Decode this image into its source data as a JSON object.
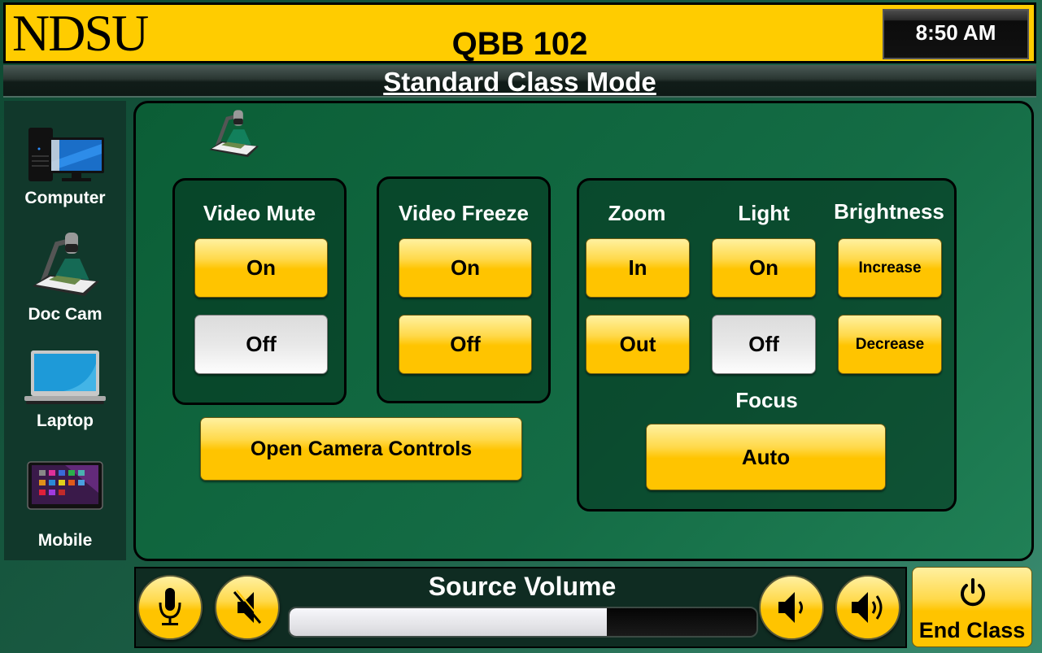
{
  "header": {
    "logo": "NDSU",
    "room": "QBB 102",
    "time": "8:50 AM"
  },
  "mode": {
    "title": "Standard Class Mode"
  },
  "sidebar": {
    "items": [
      {
        "label": "Computer",
        "icon": "computer-icon"
      },
      {
        "label": "Doc Cam",
        "icon": "document-camera-icon"
      },
      {
        "label": "Laptop",
        "icon": "laptop-icon"
      },
      {
        "label": "Mobile",
        "icon": "tablet-icon"
      }
    ]
  },
  "main": {
    "active_source_icon": "document-camera-icon",
    "video_mute": {
      "label": "Video Mute",
      "on": "On",
      "off": "Off",
      "state": "off"
    },
    "video_freeze": {
      "label": "Video Freeze",
      "on": "On",
      "off": "Off"
    },
    "zoom": {
      "label": "Zoom",
      "in": "In",
      "out": "Out"
    },
    "light": {
      "label": "Light",
      "on": "On",
      "off": "Off",
      "state": "off"
    },
    "brightness": {
      "label": "Brightness",
      "increase": "Increase",
      "decrease": "Decrease"
    },
    "focus": {
      "label": "Focus",
      "auto": "Auto"
    },
    "open_camera_controls": "Open Camera Controls"
  },
  "volume": {
    "label": "Source Volume",
    "level_percent": 68
  },
  "end_class": {
    "label": "End Class"
  },
  "colors": {
    "accent_yellow": "#ffc400",
    "header_yellow": "#ffcc00",
    "panel_green": "#0b5e36",
    "sidebar_green": "#11382b"
  }
}
